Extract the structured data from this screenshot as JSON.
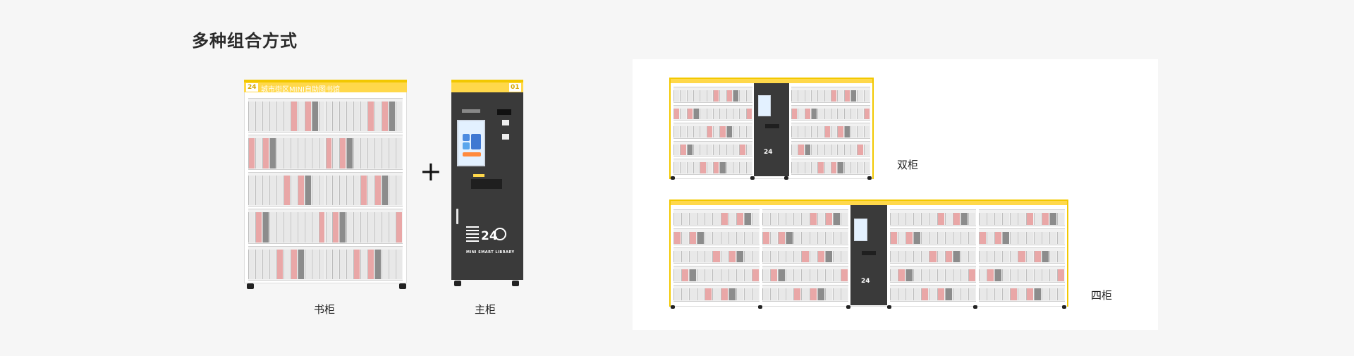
{
  "page": {
    "title": "多种组合方式"
  },
  "labels": {
    "bookcase": "书柜",
    "main_cabinet": "主柜",
    "double": "双柜",
    "quad": "四柜",
    "plus": "+"
  },
  "bookcase_header": {
    "badge": "24",
    "name": "城市街区MINI自助图书馆"
  },
  "main_cabinet": {
    "badge": "01",
    "logo_number": "24",
    "logo_text": "MINI SMART LIBRARY"
  },
  "colors": {
    "accent_yellow": "#ffd84a",
    "cabinet_dark": "#3a3a3a",
    "background": "#f6f6f6"
  }
}
